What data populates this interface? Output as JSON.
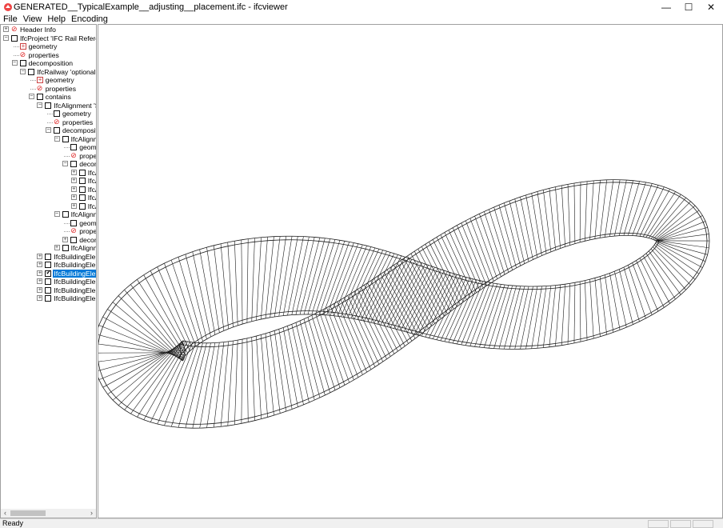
{
  "window": {
    "title": "GENERATED__TypicalExample__adjusting__placement.ifc - ifcviewer",
    "controls": {
      "minimize": "—",
      "maximize": "☐",
      "close": "✕"
    },
    "app_icon": "ifcviewer-app-icon"
  },
  "menu": [
    "File",
    "View",
    "Help",
    "Encoding"
  ],
  "tree": [
    {
      "label": "Header Info",
      "depth": 0,
      "expander": "+",
      "icon": "prop"
    },
    {
      "label": "IfcProject 'IFC Rail Referenced",
      "depth": 0,
      "expander": "-",
      "icon": "check"
    },
    {
      "label": "geometry",
      "depth": 1,
      "expander": "",
      "icon": "geom"
    },
    {
      "label": "properties",
      "depth": 1,
      "expander": "",
      "icon": "prop"
    },
    {
      "label": "decomposition",
      "depth": 1,
      "expander": "-",
      "icon": "check"
    },
    {
      "label": "IfcRailway 'optional Rai",
      "depth": 2,
      "expander": "-",
      "icon": "check"
    },
    {
      "label": "geometry",
      "depth": 3,
      "expander": "",
      "icon": "geom"
    },
    {
      "label": "properties",
      "depth": 3,
      "expander": "",
      "icon": "prop"
    },
    {
      "label": "contains",
      "depth": 3,
      "expander": "-",
      "icon": "check"
    },
    {
      "label": "IfcAlignment 'Spe",
      "depth": 4,
      "expander": "-",
      "icon": "check"
    },
    {
      "label": "geometry",
      "depth": 5,
      "expander": "",
      "icon": "check"
    },
    {
      "label": "properties",
      "depth": 5,
      "expander": "",
      "icon": "prop"
    },
    {
      "label": "decompositic",
      "depth": 5,
      "expander": "-",
      "icon": "check"
    },
    {
      "label": "IfcAlignme",
      "depth": 6,
      "expander": "-",
      "icon": "check"
    },
    {
      "label": "geome",
      "depth": 7,
      "expander": "",
      "icon": "check"
    },
    {
      "label": "proper",
      "depth": 7,
      "expander": "",
      "icon": "prop"
    },
    {
      "label": "decom",
      "depth": 7,
      "expander": "-",
      "icon": "check"
    },
    {
      "label": "IfcA",
      "depth": 8,
      "expander": "+",
      "icon": "check"
    },
    {
      "label": "IfcA",
      "depth": 8,
      "expander": "+",
      "icon": "check"
    },
    {
      "label": "IfcA",
      "depth": 8,
      "expander": "+",
      "icon": "check"
    },
    {
      "label": "IfcA",
      "depth": 8,
      "expander": "+",
      "icon": "check"
    },
    {
      "label": "IfcA",
      "depth": 8,
      "expander": "+",
      "icon": "check"
    },
    {
      "label": "IfcAlignme",
      "depth": 6,
      "expander": "-",
      "icon": "check"
    },
    {
      "label": "geome",
      "depth": 7,
      "expander": "",
      "icon": "check"
    },
    {
      "label": "proper",
      "depth": 7,
      "expander": "",
      "icon": "prop"
    },
    {
      "label": "decom",
      "depth": 7,
      "expander": "+",
      "icon": "check"
    },
    {
      "label": "IfcAlignme",
      "depth": 6,
      "expander": "+",
      "icon": "check"
    },
    {
      "label": "IfcBuildingEleme",
      "depth": 4,
      "expander": "+",
      "icon": "check"
    },
    {
      "label": "IfcBuildingEleme",
      "depth": 4,
      "expander": "+",
      "icon": "check"
    },
    {
      "label": "IfcBuildingEleme",
      "depth": 4,
      "expander": "+",
      "icon": "checked",
      "selected": true
    },
    {
      "label": "IfcBuildingEleme",
      "depth": 4,
      "expander": "+",
      "icon": "check"
    },
    {
      "label": "IfcBuildingEleme",
      "depth": 4,
      "expander": "+",
      "icon": "check"
    },
    {
      "label": "IfcBuildingEleme",
      "depth": 4,
      "expander": "+",
      "icon": "check"
    }
  ],
  "status": {
    "text": "Ready"
  },
  "colors": {
    "selection": "#0078d7",
    "prop_icon": "#d22222",
    "wireframe": "#1a1a1a"
  }
}
